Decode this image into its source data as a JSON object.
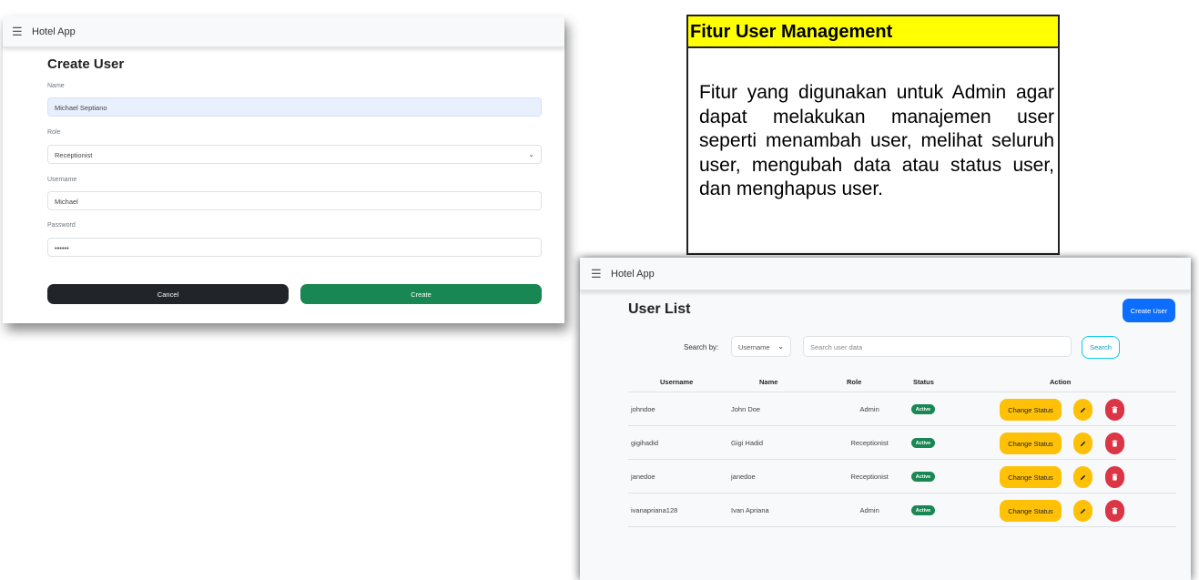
{
  "create_panel": {
    "navbar": {
      "brand": "Hotel App"
    },
    "title": "Create User",
    "fields": {
      "name": {
        "label": "Name",
        "value": "Michael Septiano"
      },
      "role": {
        "label": "Role",
        "value": "Receptionist"
      },
      "username": {
        "label": "Username",
        "value": "Michael"
      },
      "password": {
        "label": "Password",
        "value": "••••••"
      }
    },
    "buttons": {
      "cancel": "Cancel",
      "create": "Create"
    }
  },
  "text_panel": {
    "header": "Fitur User Management",
    "body": "Fitur yang digunakan untuk Admin agar dapat melakukan manajemen user seperti menambah user, melihat seluruh user, mengubah data atau status user, dan menghapus user."
  },
  "list_panel": {
    "navbar": {
      "brand": "Hotel App"
    },
    "title": "User List",
    "create_button": "Create User",
    "search": {
      "label": "Search by:",
      "select_value": "Username",
      "placeholder": "Search user data",
      "button": "Search"
    },
    "columns": [
      "Username",
      "Name",
      "Role",
      "Status",
      "Action"
    ],
    "rows": [
      {
        "username": "johndoe",
        "name": "John Doe",
        "role": "Admin",
        "status": "Active",
        "action": "Change Status"
      },
      {
        "username": "gigihadid",
        "name": "Gigi Hadid",
        "role": "Receptionist",
        "status": "Active",
        "action": "Change Status"
      },
      {
        "username": "janedoe",
        "name": "janedoe",
        "role": "Receptionist",
        "status": "Active",
        "action": "Change Status"
      },
      {
        "username": "ivanapriana128",
        "name": "Ivan Apriana",
        "role": "Admin",
        "status": "Active",
        "action": "Change Status"
      }
    ]
  },
  "icons": [
    "menu-icon",
    "chevron-down-icon",
    "pencil-icon",
    "trash-icon"
  ],
  "colors": {
    "primary": "#0d6efd",
    "success": "#198754",
    "warning": "#ffc107",
    "danger": "#dc3545",
    "dark": "#212529",
    "info": "#0dcaf0",
    "highlight": "#ffff00"
  }
}
